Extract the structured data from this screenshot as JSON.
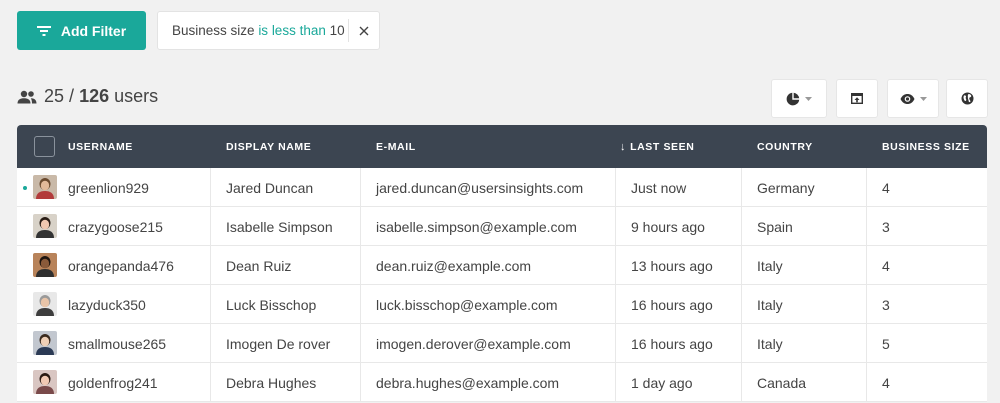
{
  "toolbar": {
    "add_filter_label": "Add Filter",
    "filter": {
      "field": "Business size",
      "operator": "is less than",
      "value": "10"
    }
  },
  "summary": {
    "shown": "25",
    "separator": "/",
    "total": "126",
    "unit": "users"
  },
  "view_buttons": {
    "chart_icon": "pie-chart-icon",
    "export_icon": "export-icon",
    "columns_icon": "eye-icon",
    "globe_icon": "globe-icon"
  },
  "table": {
    "headers": {
      "username": "USERNAME",
      "display_name": "DISPLAY NAME",
      "email": "E-MAIL",
      "last_seen": "LAST SEEN",
      "country": "COUNTRY",
      "business_size": "BUSINESS SIZE"
    },
    "rows": [
      {
        "username": "greenlion929",
        "display_name": "Jared Duncan",
        "email": "jared.duncan@usersinsights.com",
        "last_seen": "Just now",
        "country": "Germany",
        "business_size": "4"
      },
      {
        "username": "crazygoose215",
        "display_name": "Isabelle Simpson",
        "email": "isabelle.simpson@example.com",
        "last_seen": "9 hours ago",
        "country": "Spain",
        "business_size": "3"
      },
      {
        "username": "orangepanda476",
        "display_name": "Dean Ruiz",
        "email": "dean.ruiz@example.com",
        "last_seen": "13 hours ago",
        "country": "Italy",
        "business_size": "4"
      },
      {
        "username": "lazyduck350",
        "display_name": "Luck Bisschop",
        "email": "luck.bisschop@example.com",
        "last_seen": "16 hours ago",
        "country": "Italy",
        "business_size": "3"
      },
      {
        "username": "smallmouse265",
        "display_name": "Imogen De rover",
        "email": "imogen.derover@example.com",
        "last_seen": "16 hours ago",
        "country": "Italy",
        "business_size": "5"
      },
      {
        "username": "goldenfrog241",
        "display_name": "Debra Hughes",
        "email": "debra.hughes@example.com",
        "last_seen": "1 day ago",
        "country": "Canada",
        "business_size": "4"
      }
    ]
  },
  "colors": {
    "accent": "#1aa89a",
    "header_bg": "#3c4551",
    "page_bg": "#f1f1f1"
  }
}
